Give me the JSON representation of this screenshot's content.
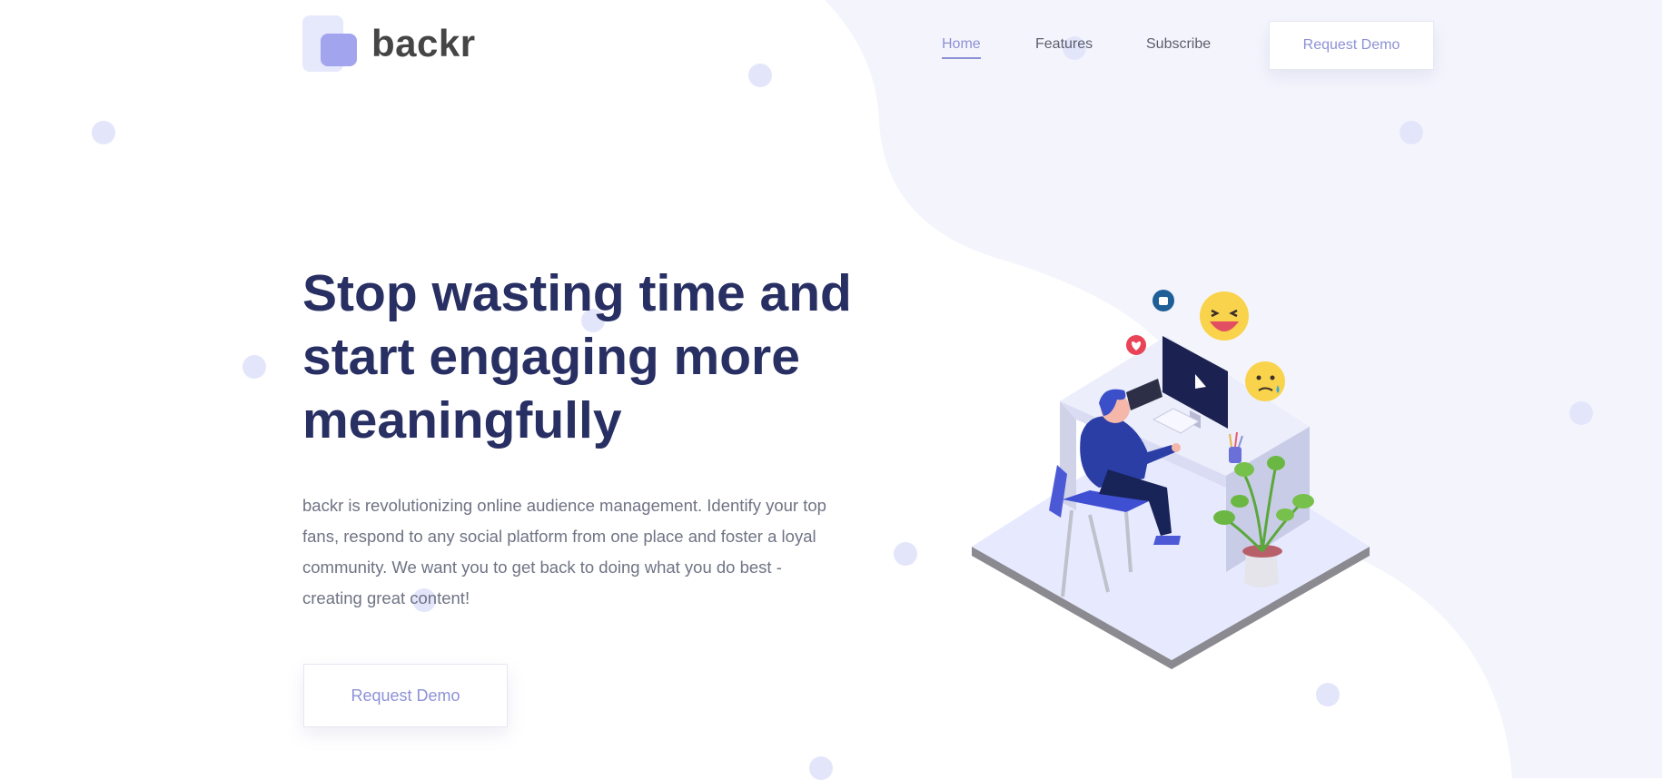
{
  "logo": {
    "text": "backr"
  },
  "nav": {
    "items": [
      {
        "label": "Home",
        "active": true
      },
      {
        "label": "Features",
        "active": false
      },
      {
        "label": "Subscribe",
        "active": false
      }
    ],
    "cta_label": "Request Demo"
  },
  "hero": {
    "title": "Stop wasting time and start engaging more meaningfully",
    "description": "backr is revolutionizing online audience management. Identify your top fans, respond to any social platform from one place and foster a loyal community. We want you to get back to doing what you do best - creating great content!",
    "cta_label": "Request Demo"
  },
  "colors": {
    "title": "#282f63",
    "accent": "#8d90d6",
    "blob": "#f4f5fc",
    "dot": "#e3e6fb"
  }
}
